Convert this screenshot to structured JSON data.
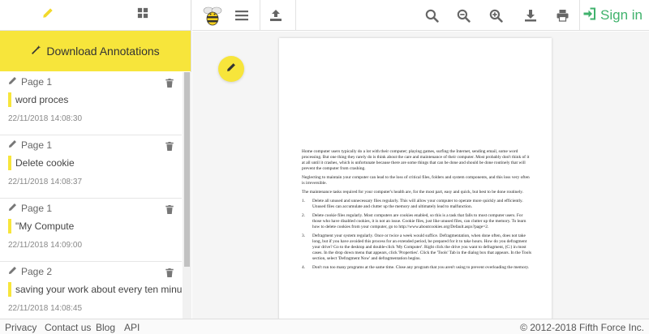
{
  "sidebar": {
    "download_label": "Download Annotations",
    "annotations": [
      {
        "page": "Page 1",
        "text": "word proces",
        "time": "22/11/2018 14:08:30"
      },
      {
        "page": "Page 1",
        "text": "Delete cookie",
        "time": "22/11/2018 14:08:37"
      },
      {
        "page": "Page 1",
        "text": "\"My Compute",
        "time": "22/11/2018 14:09:00"
      },
      {
        "page": "Page 2",
        "text": "saving your work about every ten minutes",
        "time": "22/11/2018 14:08:45"
      }
    ]
  },
  "toolbar": {
    "sign_in_label": "Sign in",
    "icons": [
      "pencil-icon",
      "grid-icon",
      "bee-logo",
      "menu-icon",
      "upload-icon",
      "search-icon",
      "zoom-out-icon",
      "zoom-in-icon",
      "download-icon",
      "print-icon",
      "sign-in-icon"
    ]
  },
  "document": {
    "intro": "Home computer users typically do a lot with their computer; playing games, surfing the Internet, sending email, some word processing.  But one thing they rarely do is think about the care and maintenance of their computer.  Most probably don't think of it at all until it crashes, which is unfortunate because there are some things that can be done and should be done routinely that will prevent the computer from crashing.",
    "para2": "Neglecting to maintain your computer can lead to the loss of critical files, folders and system components, and this loss very often is irreversible.",
    "para3": "The maintenance tasks required for your computer's health are, for the most part, easy and quick, but best to be done routinely.",
    "items": [
      {
        "num": "1.",
        "text": "Delete all unused and unnecessary files regularly. This will allow your computer to operate more quickly and efficiently. Unused files can accumulate and clutter up the memory and ultimately lead to malfunction."
      },
      {
        "num": "2.",
        "text": "Delete cookie files regularly. Most computers are cookies enabled, so this is a task that falls to most computer users. For those who have disabled cookies, it is not an issue. Cookie files, just like unused files, can clutter up the memory. To learn how to delete cookies from your computer, go to http://www.aboutcookies.org/Default.aspx?page=2."
      },
      {
        "num": "3.",
        "text": "Defragment your system regularly. Once or twice a week would suffice. Defragmentation, when done often, does not take long, but if you have avoided this process for an extended period, be prepared for it to take hours. How do you defragment your drive?  Go to the desktop and double-click 'My Computer'.  Right click the drive you want to defragment, (C:) in most cases.  In the drop down menu that appears, click 'Properties'.  Click the 'Tools' Tab in the dialog box that appears.  In the Tools section, select 'Defragment Now' and defragmentation begins."
      },
      {
        "num": "4.",
        "text": "Don't run too many programs at the same time.  Close any program that you aren't using to prevent overloading the memory."
      }
    ]
  },
  "footer": {
    "links": [
      "Privacy",
      "Contact us",
      "Blog",
      "API"
    ],
    "copyright": "© 2012-2018 Fifth Force Inc."
  },
  "colors": {
    "accent_yellow": "#f7e53b",
    "signin_green": "#3fb26c",
    "icon_gray": "#666666"
  }
}
